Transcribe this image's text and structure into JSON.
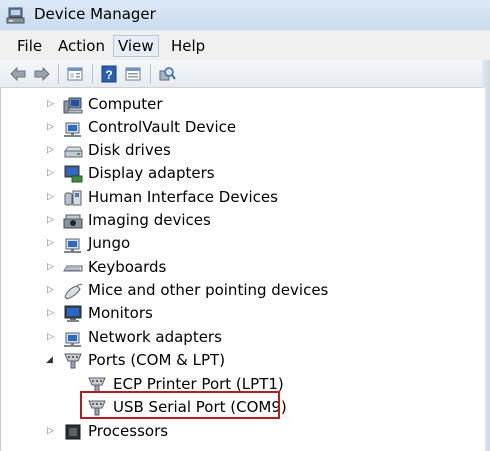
{
  "window": {
    "title": "Device Manager"
  },
  "menu": {
    "items": [
      {
        "label": "File"
      },
      {
        "label": "Action"
      },
      {
        "label": "View"
      },
      {
        "label": "Help"
      }
    ],
    "active": "View"
  },
  "toolbar": {
    "icons": [
      "back-arrow-icon",
      "forward-arrow-icon",
      "properties-icon",
      "help-icon",
      "update-driver-icon",
      "scan-hardware-icon"
    ]
  },
  "tree": {
    "categories": [
      {
        "label": "Computer",
        "icon": "computer-icon",
        "expanded": false
      },
      {
        "label": "ControlVault Device",
        "icon": "controlvault-icon",
        "expanded": false
      },
      {
        "label": "Disk drives",
        "icon": "disk-drive-icon",
        "expanded": false
      },
      {
        "label": "Display adapters",
        "icon": "display-adapter-icon",
        "expanded": false
      },
      {
        "label": "Human Interface Devices",
        "icon": "hid-icon",
        "expanded": false
      },
      {
        "label": "Imaging devices",
        "icon": "imaging-icon",
        "expanded": false
      },
      {
        "label": "Jungo",
        "icon": "jungo-icon",
        "expanded": false
      },
      {
        "label": "Keyboards",
        "icon": "keyboard-icon",
        "expanded": false
      },
      {
        "label": "Mice and other pointing devices",
        "icon": "mouse-icon",
        "expanded": false
      },
      {
        "label": "Monitors",
        "icon": "monitor-icon",
        "expanded": false
      },
      {
        "label": "Network adapters",
        "icon": "network-adapter-icon",
        "expanded": false
      },
      {
        "label": "Ports (COM & LPT)",
        "icon": "port-icon",
        "expanded": true
      },
      {
        "label": "ECP Printer Port (LPT1)",
        "icon": "port-icon",
        "child": true
      },
      {
        "label": "USB Serial Port (COM9)",
        "icon": "port-icon",
        "child": true,
        "highlighted": true
      },
      {
        "label": "Processors",
        "icon": "processor-icon",
        "expanded": false
      }
    ]
  },
  "colors": {
    "highlight_border": "#b02023",
    "titlebar": "#c9dbef"
  }
}
